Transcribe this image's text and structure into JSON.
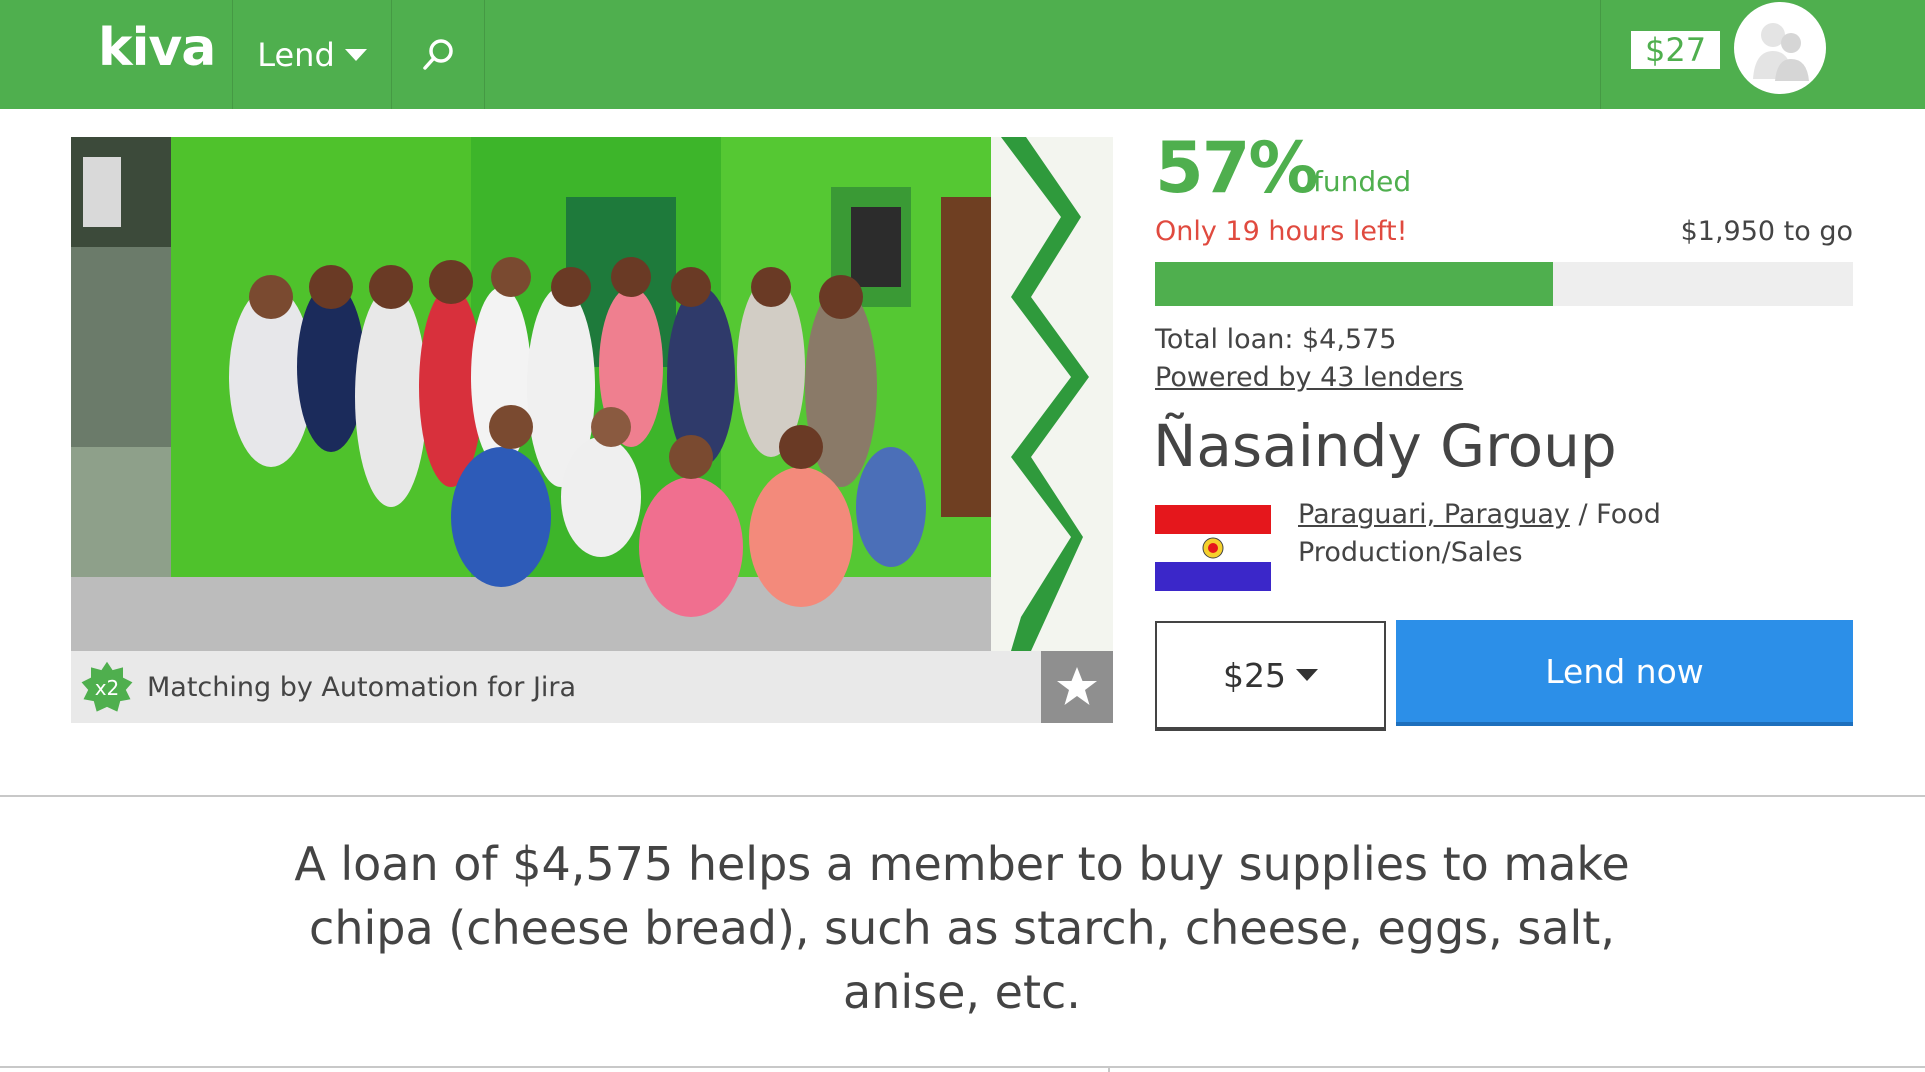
{
  "nav": {
    "logo": "kiva",
    "lend_label": "Lend",
    "balance": "$27",
    "brand_color": "#4faf4e"
  },
  "photo": {
    "matching_badge": "x2",
    "matching_text": "Matching by Automation for Jira"
  },
  "loan": {
    "percent": "57%",
    "percent_value": 57,
    "funded_label": "funded",
    "time_left": "Only 19 hours left!",
    "to_go": "$1,950 to go",
    "total_loan": "Total loan: $4,575",
    "lenders_link": "Powered by 43 lenders",
    "borrower_name": "Ñasaindy Group",
    "location_link": "Paraguari, Paraguay",
    "location_separator": " / ",
    "sector": "Food Production/Sales",
    "flag_icon": "paraguay-flag-icon",
    "amount": "$25",
    "lend_button": "Lend now",
    "lend_button_color": "#2c8fe8",
    "urgent_color": "#e04a3f"
  },
  "description": "A loan of $4,575 helps a member to buy supplies to make chipa (cheese bread), such as starch, cheese, eggs, salt, anise, etc."
}
